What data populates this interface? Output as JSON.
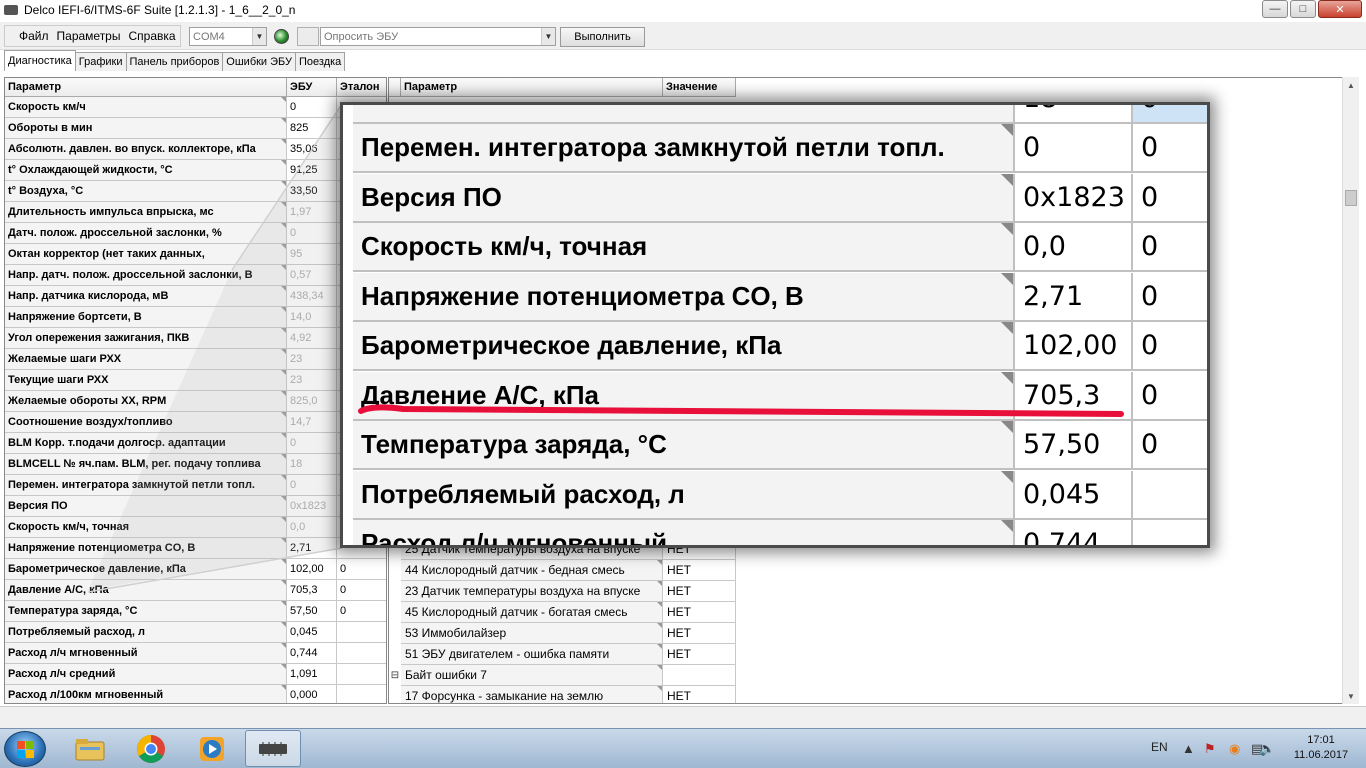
{
  "window": {
    "title": "Delco IEFI-6/ITMS-6F Suite [1.2.1.3] - 1_6__2_0_n",
    "min_icon": "minimize-icon",
    "max_icon": "maximize-icon",
    "close_icon": "close-icon"
  },
  "menu": {
    "file": "Файл",
    "params": "Параметры",
    "help": "Справка"
  },
  "toolbar": {
    "port": "COM4",
    "query": "Опросить ЭБУ",
    "execute": "Выполнить"
  },
  "tabs": [
    "Диагностика",
    "Графики",
    "Панель приборов",
    "Ошибки ЭБУ",
    "Поездка"
  ],
  "left_table": {
    "headers": [
      "Параметр",
      "ЭБУ",
      "Эталон"
    ],
    "rows": [
      [
        "Скорость км/ч",
        "0",
        ""
      ],
      [
        "Обороты в мин",
        "825",
        ""
      ],
      [
        "Абсолютн. давлен. во впуск. коллекторе, кПа",
        "35,06",
        ""
      ],
      [
        "t° Охлаждающей жидкости, °С",
        "91,25",
        ""
      ],
      [
        "t° Воздуха, °С",
        "33,50",
        ""
      ],
      [
        "Длительность импульса впрыска, мс",
        "1,97",
        ""
      ],
      [
        "Датч. полож. дроссельной заслонки, %",
        "0",
        ""
      ],
      [
        "Октан корректор (нет таких данных,",
        "95",
        ""
      ],
      [
        "Напр. датч. полож. дроссельной заслонки, В",
        "0,57",
        ""
      ],
      [
        "Напр. датчика кислорода, мВ",
        "438,34",
        ""
      ],
      [
        "Напряжение бортсети, В",
        "14,0",
        ""
      ],
      [
        "Угол опережения зажигания, ПКВ",
        "4,92",
        ""
      ],
      [
        "Желаемые шаги РХХ",
        "23",
        ""
      ],
      [
        "Текущие шаги РХХ",
        "23",
        ""
      ],
      [
        "Желаемые обороты ХХ, RPM",
        "825,0",
        ""
      ],
      [
        "Соотношение воздух/топливо",
        "14,7",
        ""
      ],
      [
        "BLM Корр. т.подачи долгоср. адаптации",
        "0",
        ""
      ],
      [
        "BLMCELL № яч.пам. BLM, рег. подачу топлива",
        "18",
        ""
      ],
      [
        "Перемен. интегратора замкнутой петли топл.",
        "0",
        ""
      ],
      [
        "Версия ПО",
        "0x1823",
        ""
      ],
      [
        "Скорость км/ч, точная",
        "0,0",
        ""
      ],
      [
        "Напряжение потенциометра CO, В",
        "2,71",
        ""
      ],
      [
        "Барометрическое давление, кПа",
        "102,00",
        "0"
      ],
      [
        "Давление А/С, кПа",
        "705,3",
        "0"
      ],
      [
        "Температура заряда, °С",
        "57,50",
        "0"
      ],
      [
        "Потребляемый расход, л",
        "0,045",
        ""
      ],
      [
        "Расход л/ч мгновенный",
        "0,744",
        ""
      ],
      [
        "Расход л/ч средний",
        "1,091",
        ""
      ],
      [
        "Расход л/100км мгновенный",
        "0,000",
        ""
      ]
    ]
  },
  "right_table": {
    "headers": [
      "Параметр",
      "Значение"
    ],
    "rows": [
      [
        "25 Датчик температуры воздуха на впуске",
        "НЕТ"
      ],
      [
        "44 Кислородный датчик - бедная смесь",
        "НЕТ"
      ],
      [
        "23 Датчик температуры воздуха на впуске",
        "НЕТ"
      ],
      [
        "45 Кислородный датчик - богатая смесь",
        "НЕТ"
      ],
      [
        "53 Иммобилайзер",
        "НЕТ"
      ],
      [
        "51 ЭБУ двигателем - ошибка памяти",
        "НЕТ"
      ],
      [
        "Байт ошибки 7",
        ""
      ],
      [
        "17 Форсунка - замыкание на землю",
        "НЕТ"
      ]
    ]
  },
  "zoom": {
    "top_partial": [
      "18",
      "0"
    ],
    "rows": [
      [
        "Перемен. интегратора замкнутой петли топл.",
        "0",
        "0"
      ],
      [
        "Версия ПО",
        "0x1823",
        "0"
      ],
      [
        "Скорость км/ч, точная",
        "0,0",
        "0"
      ],
      [
        "Напряжение потенциометра CO, В",
        "2,71",
        "0"
      ],
      [
        "Барометрическое давление, кПа",
        "102,00",
        "0"
      ],
      [
        "Давление А/С, кПа",
        "705,3",
        "0"
      ],
      [
        "Температура заряда, °С",
        "57,50",
        "0"
      ],
      [
        "Потребляемый расход, л",
        "0,045",
        ""
      ],
      [
        "Расход л/ч мгновенный",
        "0,744",
        ""
      ]
    ],
    "highlight_color": "#e8103a"
  },
  "taskbar": {
    "apps": [
      "explorer-icon",
      "chrome-icon",
      "media-player-icon",
      "ecu-chip-icon"
    ],
    "lang": "EN",
    "time": "17:01",
    "date": "11.06.2017"
  }
}
